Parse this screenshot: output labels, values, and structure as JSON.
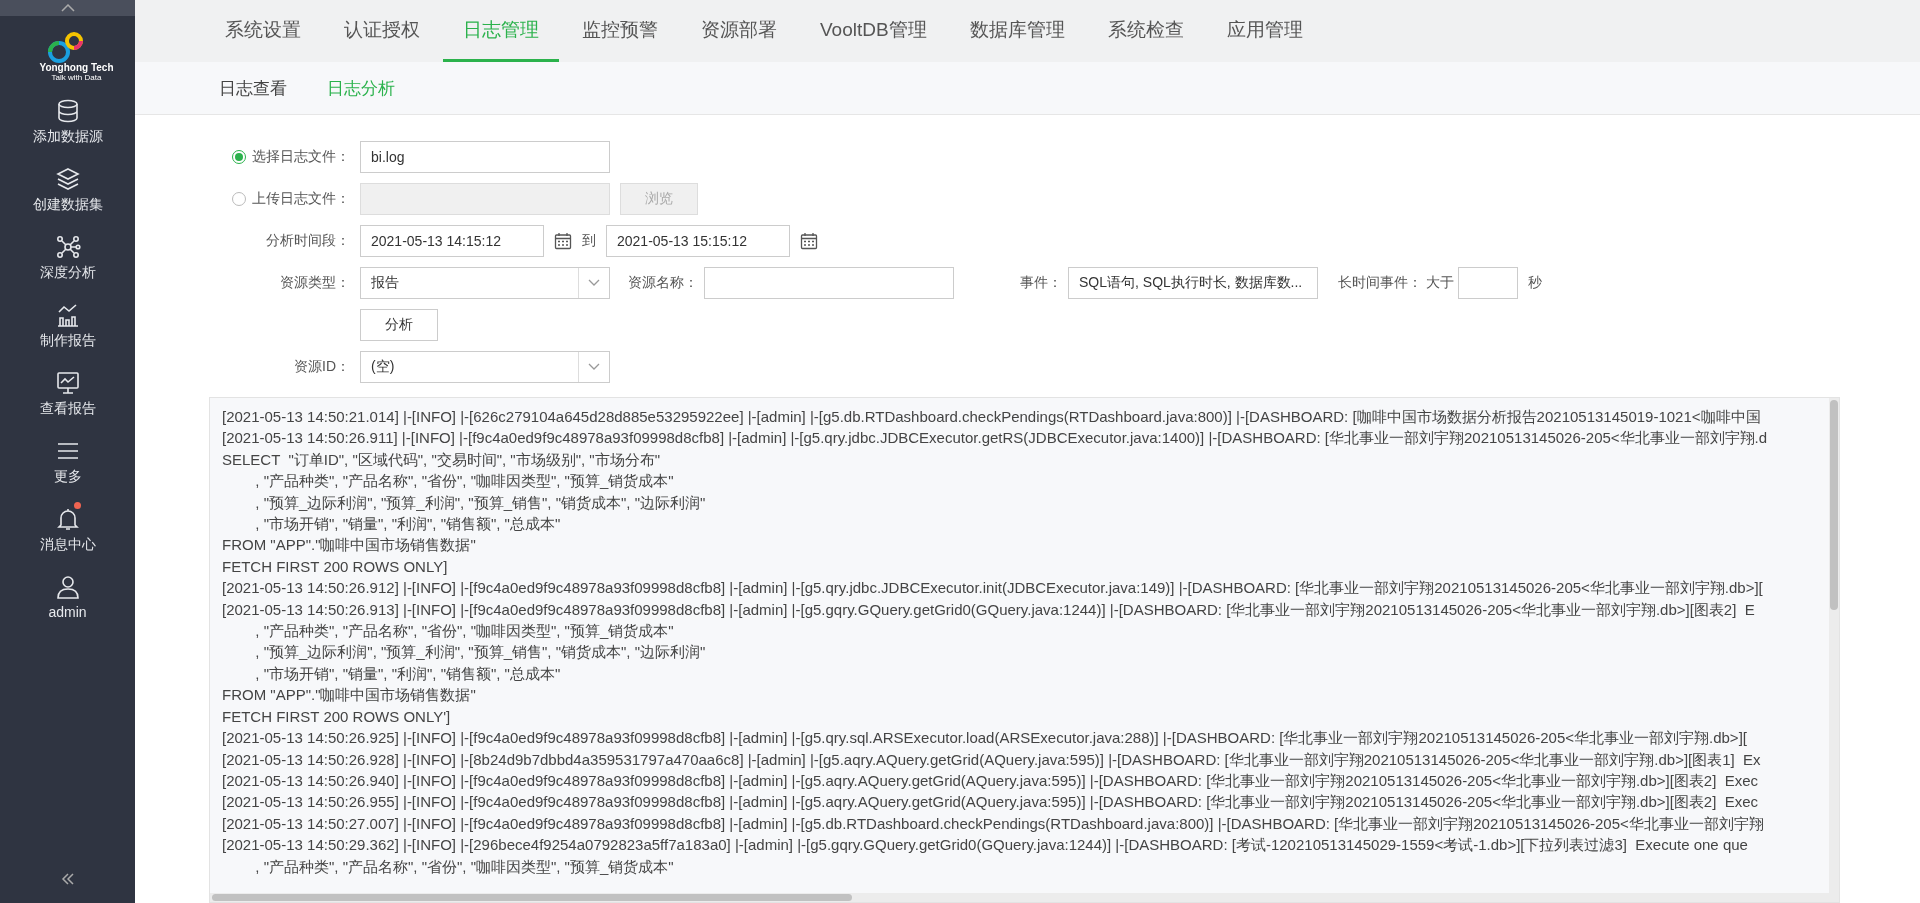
{
  "sidebar": {
    "logo": {
      "name": "Yonghong Tech",
      "tagline": "Talk with Data"
    },
    "items": [
      {
        "kind": "database",
        "label": "添加数据源"
      },
      {
        "kind": "layers",
        "label": "创建数据集"
      },
      {
        "kind": "network",
        "label": "深度分析"
      },
      {
        "kind": "chart",
        "label": "制作报告"
      },
      {
        "kind": "monitor",
        "label": "查看报告"
      },
      {
        "kind": "menu",
        "label": "更多"
      },
      {
        "kind": "bell",
        "label": "消息中心",
        "badge": true
      },
      {
        "kind": "user",
        "label": "admin"
      }
    ]
  },
  "tabs": [
    {
      "label": "系统设置",
      "selected": false
    },
    {
      "label": "认证授权",
      "selected": false
    },
    {
      "label": "日志管理",
      "selected": true
    },
    {
      "label": "监控预警",
      "selected": false
    },
    {
      "label": "资源部署",
      "selected": false
    },
    {
      "label": "VooltDB管理",
      "selected": false
    },
    {
      "label": "数据库管理",
      "selected": false
    },
    {
      "label": "系统检查",
      "selected": false
    },
    {
      "label": "应用管理",
      "selected": false
    }
  ],
  "subtabs": [
    {
      "label": "日志查看",
      "selected": false
    },
    {
      "label": "日志分析",
      "selected": true
    }
  ],
  "form": {
    "file_options": [
      {
        "label": "选择日志文件：",
        "selected": true,
        "value": "bi.log"
      },
      {
        "label": "上传日志文件：",
        "selected": false,
        "button": "浏览"
      }
    ],
    "time_range": {
      "label": "分析时间段：",
      "from": "2021-05-13 14:15:12",
      "separator": "到",
      "to": "2021-05-13 15:15:12"
    },
    "resource_type": {
      "label": "资源类型：",
      "value": "报告"
    },
    "resource_name": {
      "label": "资源名称："
    },
    "events": {
      "label": "事件：",
      "value": "SQL语句, SQL执行时长, 数据库数..."
    },
    "long_event": {
      "label": "长时间事件：",
      "prefix": "大于",
      "suffix": "秒"
    },
    "analyze_button": "分析",
    "resource_id": {
      "label": "资源ID：",
      "value": "(空)"
    }
  },
  "log_lines": [
    "[2021-05-13 14:50:21.014] |-[INFO] |-[626c279104a645d28d885e53295922ee] |-[admin] |-[g5.db.RTDashboard.checkPendings(RTDashboard.java:800)] |-[DASHBOARD: [咖啡中国市场数据分析报告20210513145019-1021<咖啡中国",
    "[2021-05-13 14:50:26.911] |-[INFO] |-[f9c4a0ed9f9c48978a93f09998d8cfb8] |-[admin] |-[g5.qry.jdbc.JDBCExecutor.getRS(JDBCExecutor.java:1400)] |-[DASHBOARD: [华北事业一部刘宇翔20210513145026-205<华北事业一部刘宇翔.d",
    "SELECT  \"订单ID\", \"区域代码\", \"交易时间\", \"市场级别\", \"市场分布\"",
    "        , \"产品种类\", \"产品名称\", \"省份\", \"咖啡因类型\", \"预算_销货成本\"",
    "        , \"预算_边际利润\", \"预算_利润\", \"预算_销售\", \"销货成本\", \"边际利润\"",
    "        , \"市场开销\", \"销量\", \"利润\", \"销售额\", \"总成本\"",
    "FROM \"APP\".\"咖啡中国市场销售数据\"",
    "FETCH FIRST 200 ROWS ONLY]",
    "[2021-05-13 14:50:26.912] |-[INFO] |-[f9c4a0ed9f9c48978a93f09998d8cfb8] |-[admin] |-[g5.qry.jdbc.JDBCExecutor.init(JDBCExecutor.java:149)] |-[DASHBOARD: [华北事业一部刘宇翔20210513145026-205<华北事业一部刘宇翔.db>][",
    "[2021-05-13 14:50:26.913] |-[INFO] |-[f9c4a0ed9f9c48978a93f09998d8cfb8] |-[admin] |-[g5.gqry.GQuery.getGrid0(GQuery.java:1244)] |-[DASHBOARD: [华北事业一部刘宇翔20210513145026-205<华北事业一部刘宇翔.db>][图表2]  E",
    "        , \"产品种类\", \"产品名称\", \"省份\", \"咖啡因类型\", \"预算_销货成本\"",
    "        , \"预算_边际利润\", \"预算_利润\", \"预算_销售\", \"销货成本\", \"边际利润\"",
    "        , \"市场开销\", \"销量\", \"利润\", \"销售额\", \"总成本\"",
    "FROM \"APP\".\"咖啡中国市场销售数据\"",
    "FETCH FIRST 200 ROWS ONLY']",
    "[2021-05-13 14:50:26.925] |-[INFO] |-[f9c4a0ed9f9c48978a93f09998d8cfb8] |-[admin] |-[g5.qry.sql.ARSExecutor.load(ARSExecutor.java:288)] |-[DASHBOARD: [华北事业一部刘宇翔20210513145026-205<华北事业一部刘宇翔.db>][",
    "[2021-05-13 14:50:26.928] |-[INFO] |-[8b24d9b7dbbd4a359531797a470aa6c8] |-[admin] |-[g5.aqry.AQuery.getGrid(AQuery.java:595)] |-[DASHBOARD: [华北事业一部刘宇翔20210513145026-205<华北事业一部刘宇翔.db>][图表1]  Ex",
    "[2021-05-13 14:50:26.940] |-[INFO] |-[f9c4a0ed9f9c48978a93f09998d8cfb8] |-[admin] |-[g5.aqry.AQuery.getGrid(AQuery.java:595)] |-[DASHBOARD: [华北事业一部刘宇翔20210513145026-205<华北事业一部刘宇翔.db>][图表2]  Exec",
    "[2021-05-13 14:50:26.955] |-[INFO] |-[f9c4a0ed9f9c48978a93f09998d8cfb8] |-[admin] |-[g5.aqry.AQuery.getGrid(AQuery.java:595)] |-[DASHBOARD: [华北事业一部刘宇翔20210513145026-205<华北事业一部刘宇翔.db>][图表2]  Exec",
    "[2021-05-13 14:50:27.007] |-[INFO] |-[f9c4a0ed9f9c48978a93f09998d8cfb8] |-[admin] |-[g5.db.RTDashboard.checkPendings(RTDashboard.java:800)] |-[DASHBOARD: [华北事业一部刘宇翔20210513145026-205<华北事业一部刘宇翔",
    "[2021-05-13 14:50:29.362] |-[INFO] |-[296bece4f9254a0792823a5ff7a183a0] |-[admin] |-[g5.gqry.GQuery.getGrid0(GQuery.java:1244)] |-[DASHBOARD: [考试-120210513145029-1559<考试-1.db>][下拉列表过滤3]  Execute one que",
    "        , \"产品种类\", \"产品名称\", \"省份\", \"咖啡因类型\", \"预算_销货成本\""
  ]
}
